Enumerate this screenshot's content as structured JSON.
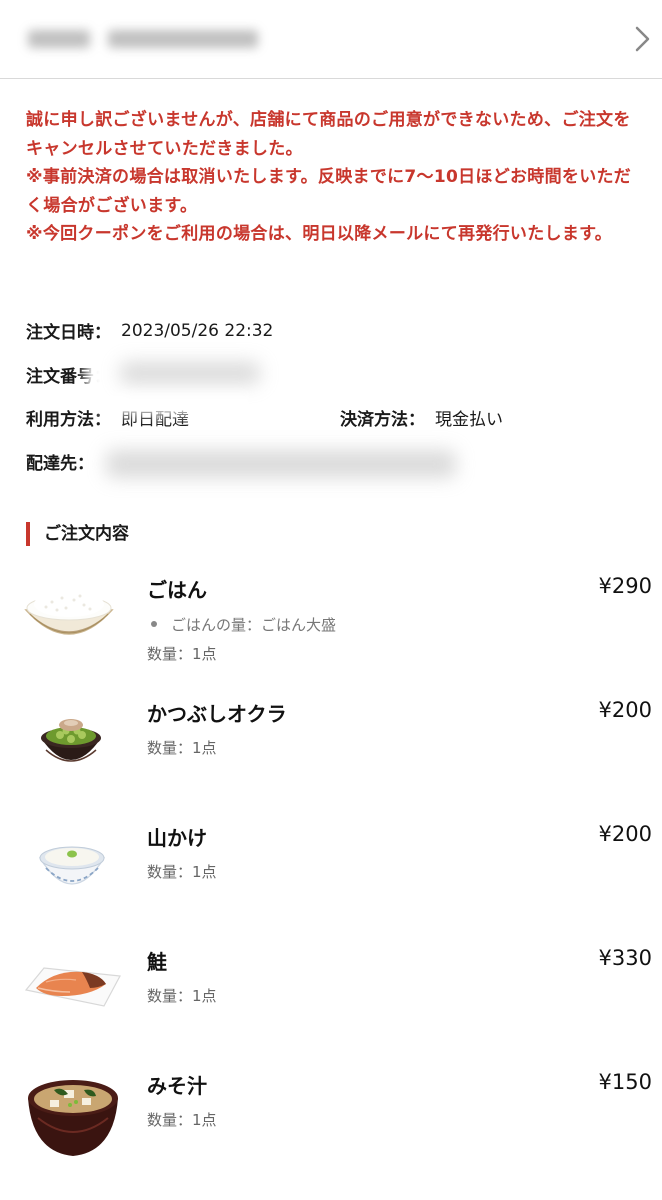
{
  "notice": {
    "line1": "誠に申し訳ございませんが、店舗にて商品のご用意ができないため、ご注文をキャンセルさせていただきました。",
    "line2": "※事前決済の場合は取消いたします。反映までに7〜10日ほどお時間をいただく場合がございます。",
    "line3": "※今回クーポンをご利用の場合は、明日以降メールにて再発行いたします。"
  },
  "order": {
    "date_label": "注文日時：",
    "date_value": "2023/05/26 22:32",
    "number_label": "注文番号：",
    "usage_label": "利用方法：",
    "usage_value": "即日配達",
    "payment_label": "決済方法：",
    "payment_value": "現金払い",
    "delivery_label": "配達先："
  },
  "section_title": "ご注文内容",
  "items": [
    {
      "name": "ごはん",
      "price": "¥290",
      "option": "ごはんの量：ごはん大盛",
      "qty": "数量：1点",
      "icon": "rice-bowl-icon"
    },
    {
      "name": "かつぶしオクラ",
      "price": "¥200",
      "qty": "数量：1点",
      "icon": "okra-bowl-icon"
    },
    {
      "name": "山かけ",
      "price": "¥200",
      "qty": "数量：1点",
      "icon": "yamakake-bowl-icon"
    },
    {
      "name": "鮭",
      "price": "¥330",
      "qty": "数量：1点",
      "icon": "salmon-plate-icon"
    },
    {
      "name": "みそ汁",
      "price": "¥150",
      "qty": "数量：1点",
      "icon": "miso-soup-bowl-icon"
    }
  ],
  "colors": {
    "accent": "#c8372d",
    "divider": "#d9d9d9"
  }
}
